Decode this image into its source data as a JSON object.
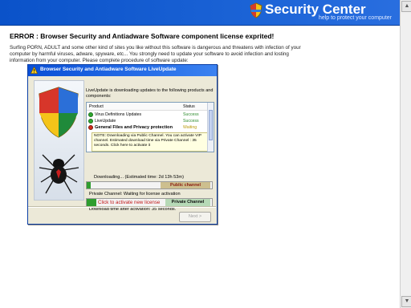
{
  "header": {
    "brand_title": "Security Center",
    "tagline": "help to protect your computer",
    "accent_color": "#0a52c9"
  },
  "page": {
    "error_title": "ERROR : Browser Security and Antiadware Software component license exprited!",
    "description": "Surfing PORN, ADULT and some other kind of sites you like without this software is dangerous and threatens with infection of your computer by harmful viruses, adware, spyware, etc... You strongly need to update your software to avoid infection and losting information from your computer. Please complete procedure of software update:"
  },
  "dialog": {
    "title": "Browser Security and Antiadware Software LiveUpdate",
    "title_icon": "warning-icon",
    "intro": "LiveUpdate is downloading updates to the following products and components:",
    "columns": {
      "product": "Product",
      "status": "Status"
    },
    "rows": [
      {
        "name": "Virus Definitions Updates",
        "status": "Success",
        "icon": "check-icon"
      },
      {
        "name": "LiveUpdate",
        "status": "Success",
        "icon": "check-icon"
      },
      {
        "name": "General Files and Privacy protection",
        "status": "Waiting",
        "icon": "error-icon"
      }
    ],
    "note": "NOTE: Downloading via Public Channel. You can activate VIP channel. Estimated download time via Private Channel : 35 seconds. Click here to activate it",
    "downloading_label": "Downloading... (Estimated time: 2d 13h 53m)",
    "public_channel_label": "Public channel",
    "private_channel_label": "Private Channel: Waiting for license activation",
    "activate_link": "Click to activate new license",
    "private_channel_badge": "Private Channel",
    "after_activation": "Download time after activation: 35 seconds.",
    "next_button": "Next >",
    "download_progress": 0.03,
    "activation_progress": 0.08
  }
}
